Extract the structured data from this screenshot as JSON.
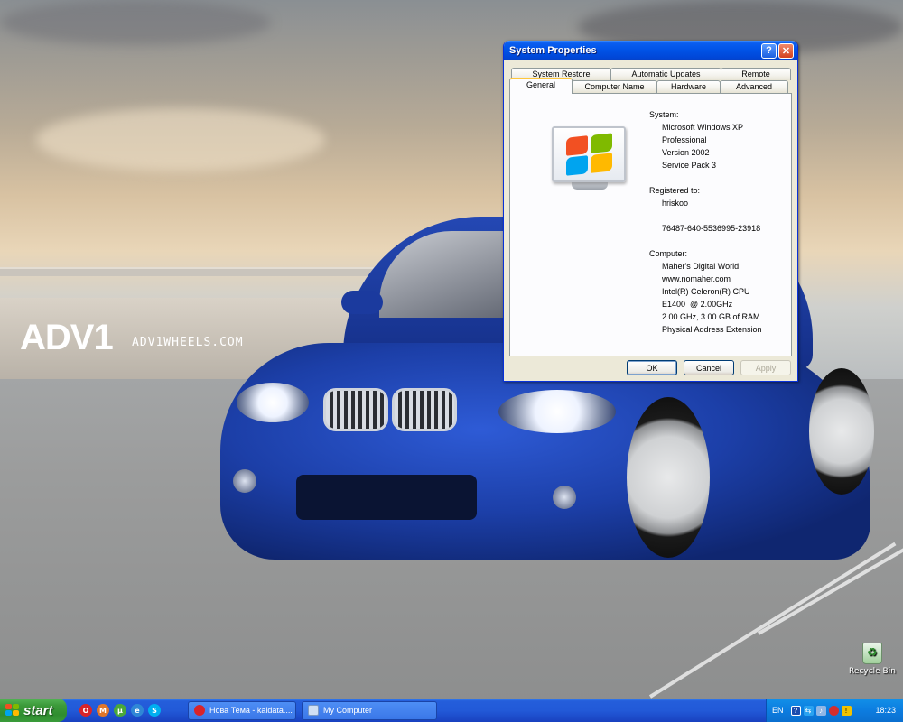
{
  "wallpaper": {
    "logo": "ADV1",
    "url": "ADV1WHEELS.COM"
  },
  "desktop_icons": [
    {
      "label": "Recycle Bin",
      "icon": "recycle-bin-icon"
    }
  ],
  "window": {
    "title": "System Properties",
    "help_label": "?",
    "close_label": "✕",
    "tabs_back": [
      "System Restore",
      "Automatic Updates",
      "Remote"
    ],
    "tabs_front": [
      "General",
      "Computer Name",
      "Hardware",
      "Advanced"
    ],
    "active_tab": "General",
    "system": {
      "heading": "System:",
      "os": "Microsoft Windows XP",
      "edition": "Professional",
      "version": "Version 2002",
      "service_pack": "Service Pack 3"
    },
    "registered": {
      "heading": "Registered to:",
      "user": "hriskoo",
      "product_id": "76487-640-5536995-23918"
    },
    "computer": {
      "heading": "Computer:",
      "name": "Maher's Digital World",
      "site": "www.nomaher.com",
      "cpu": "Intel(R) Celeron(R) CPU",
      "cpu_model": "E1400  @ 2.00GHz",
      "speed_ram": "2.00 GHz, 3.00 GB of RAM",
      "pae": "Physical Address Extension"
    },
    "buttons": {
      "ok": "OK",
      "cancel": "Cancel",
      "apply": "Apply"
    }
  },
  "taskbar": {
    "start_label": "start",
    "tasks": [
      {
        "label": "Нова Тема - kaldata....",
        "icon": "opera-icon"
      },
      {
        "label": "My Computer",
        "icon": "my-computer-icon"
      }
    ],
    "tray": {
      "language": "EN",
      "help": "?",
      "time": "18:23"
    }
  },
  "colors": {
    "title_bar": "#0052e6",
    "start_green": "#3c9a3a",
    "tab_highlight": "#ffc73c",
    "taskbar_blue": "#225ad8"
  }
}
